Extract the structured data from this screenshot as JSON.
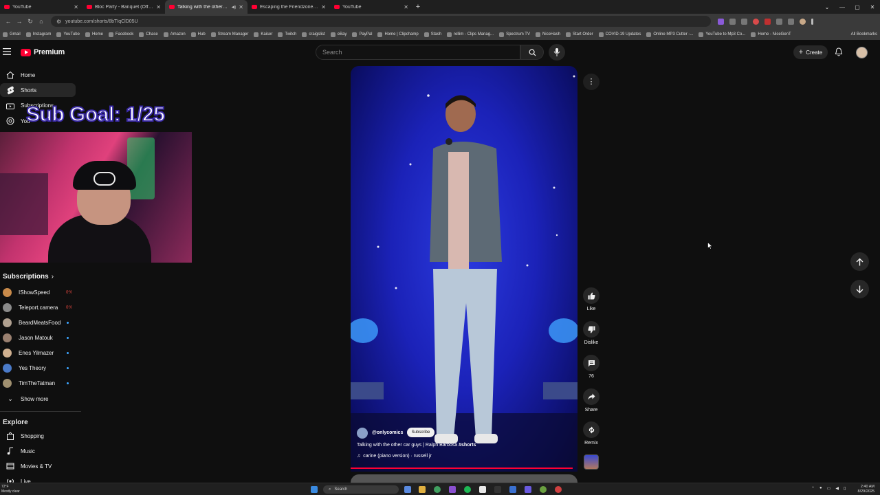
{
  "browser": {
    "tabs": [
      {
        "title": "YouTube",
        "active": false
      },
      {
        "title": "Bloc Party - Banquet (Official M",
        "active": false
      },
      {
        "title": "Talking with the other car g",
        "active": true
      },
      {
        "title": "Escaping the Friendzone - YouT",
        "active": false
      },
      {
        "title": "YouTube",
        "active": false
      }
    ],
    "url": "youtube.com/shorts/8bTIqClD05U",
    "bookmarks": [
      "Gmail",
      "Instagram",
      "YouTube",
      "Home",
      "Facebook",
      "Chase",
      "Amazon",
      "Hub",
      "Stream Manager",
      "Kaiser",
      "Twitch",
      "craigslist",
      "eBay",
      "PayPal",
      "Home | Clipchamp",
      "Stash",
      "rellim - Clips Manag...",
      "Spectrum TV",
      "NiceHash",
      "Start Order",
      "COVID-19 Updates",
      "Online MP3 Cutter -...",
      "YouTube to Mp3 Co...",
      "Home - NiceGenT"
    ],
    "all_bookmarks": "All Bookmarks"
  },
  "header": {
    "logo_text": "Premium",
    "search_placeholder": "Search",
    "create_label": "Create"
  },
  "sidebar": {
    "nav": [
      {
        "label": "Home",
        "icon": "home-icon"
      },
      {
        "label": "Shorts",
        "icon": "shorts-icon"
      },
      {
        "label": "Subscriptions",
        "icon": "subscriptions-icon"
      },
      {
        "label": "You",
        "icon": "you-icon"
      }
    ],
    "subscriptions_heading": "Subscriptions",
    "subscriptions": [
      {
        "name": "IShowSpeed",
        "color": "#c88a4a",
        "live": true
      },
      {
        "name": "Teleport.camera",
        "color": "#8a8a8a",
        "live": true
      },
      {
        "name": "BeardMeatsFood",
        "color": "#b0a090",
        "live": false
      },
      {
        "name": "Jason Matouk",
        "color": "#9a8070",
        "live": false
      },
      {
        "name": "Enes Yilmazer",
        "color": "#d0b090",
        "live": false
      },
      {
        "name": "Yes Theory",
        "color": "#4a7ac8",
        "live": false
      },
      {
        "name": "TimTheTatman",
        "color": "#a09070",
        "live": false
      }
    ],
    "show_more": "Show more",
    "explore_heading": "Explore",
    "explore": [
      {
        "label": "Shopping",
        "icon": "shopping-icon"
      },
      {
        "label": "Music",
        "icon": "music-icon"
      },
      {
        "label": "Movies & TV",
        "icon": "movies-icon"
      },
      {
        "label": "Live",
        "icon": "live-icon"
      }
    ]
  },
  "overlay": {
    "sub_goal": "Sub Goal: 1/25"
  },
  "short": {
    "channel": "@onlycomics",
    "subscribe": "Subscribe",
    "title": "Talking with the other car guys | Ralph Barbosa",
    "hashtag": "#shorts",
    "music": "carine (piano version) · russell jr",
    "progress_fraction": 0.99
  },
  "actions": {
    "like": "Like",
    "dislike": "Dislike",
    "comments": "76",
    "share": "Share",
    "remix": "Remix"
  },
  "taskbar": {
    "temp": "72°F",
    "weather": "Mostly clear",
    "search": "Search",
    "time": "2:40 AM",
    "date": "8/29/2025"
  }
}
